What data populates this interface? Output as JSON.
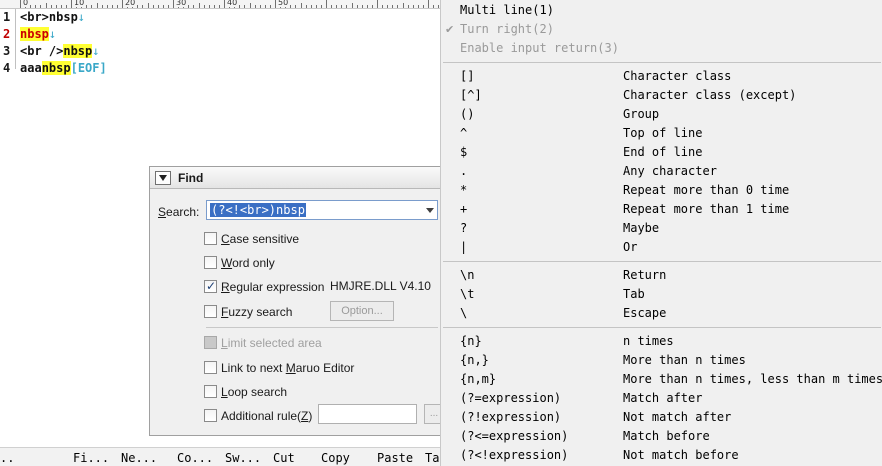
{
  "ruler": {
    "marks": [
      "0",
      "10",
      "20",
      "30",
      "40",
      "50"
    ]
  },
  "editor": {
    "lines": [
      {
        "num": "1",
        "segments": [
          {
            "text": "<br>nbsp",
            "style": ""
          },
          {
            "text": "↓",
            "style": "lf"
          }
        ]
      },
      {
        "num": "2",
        "segments": [
          {
            "text": "nbsp",
            "style": "hl-yel hl-red"
          },
          {
            "text": "↓",
            "style": "lf"
          }
        ]
      },
      {
        "num": "3",
        "segments": [
          {
            "text": "<br />",
            "style": ""
          },
          {
            "text": "nbsp",
            "style": "hl-yel"
          },
          {
            "text": "↓",
            "style": "lf"
          }
        ]
      },
      {
        "num": "4",
        "segments": [
          {
            "text": "aaa",
            "style": ""
          },
          {
            "text": "nbsp",
            "style": "hl-yel"
          },
          {
            "text": "[EOF]",
            "style": "eof"
          }
        ]
      }
    ]
  },
  "find": {
    "title": "Find",
    "search_label": "Search:",
    "search_value": "(?<!<br>)nbsp",
    "options": {
      "case_sensitive": "Case sensitive",
      "word_only": "Word only",
      "regular_expression": "Regular expression",
      "fuzzy_search": "Fuzzy search",
      "limit_selected_area": "Limit selected area",
      "link_next": "Link to next Maruo Editor",
      "loop_search": "Loop search",
      "additional_rule": "Additional rule(Z)"
    },
    "dll_version": "HMJRE.DLL V4.10",
    "option_button": "Option...",
    "more_button": "..."
  },
  "statusbar": {
    "items": [
      "..",
      "Fi...",
      "Ne...",
      "Co...",
      "Sw...",
      "Cut",
      "Copy",
      "Paste",
      "Ta"
    ]
  },
  "menu": {
    "top": [
      {
        "label": "Multi line(1)",
        "enabled": true,
        "checked": false
      },
      {
        "label": "Turn right(2)",
        "enabled": false,
        "checked": true
      },
      {
        "label": "Enable input return(3)",
        "enabled": false,
        "checked": false
      }
    ],
    "groups": [
      [
        {
          "key": "[]",
          "desc": "Character class"
        },
        {
          "key": "[^]",
          "desc": "Character class (except)"
        },
        {
          "key": "()",
          "desc": "Group"
        },
        {
          "key": "^",
          "desc": "Top of line"
        },
        {
          "key": "$",
          "desc": "End of line"
        },
        {
          "key": ".",
          "desc": "Any character"
        },
        {
          "key": "*",
          "desc": "Repeat more than 0 time"
        },
        {
          "key": "+",
          "desc": "Repeat more than 1 time"
        },
        {
          "key": "?",
          "desc": "Maybe"
        },
        {
          "key": "|",
          "desc": "Or"
        }
      ],
      [
        {
          "key": "\\n",
          "desc": "Return"
        },
        {
          "key": "\\t",
          "desc": "Tab"
        },
        {
          "key": "\\",
          "desc": "Escape"
        }
      ],
      [
        {
          "key": "{n}",
          "desc": "n times"
        },
        {
          "key": "{n,}",
          "desc": "More than n times"
        },
        {
          "key": "{n,m}",
          "desc": "More than n times, less than m times"
        },
        {
          "key": "(?=expression)",
          "desc": "Match after"
        },
        {
          "key": "(?!expression)",
          "desc": "Not match after"
        },
        {
          "key": "(?<=expression)",
          "desc": "Match before"
        },
        {
          "key": "(?<!expression)",
          "desc": "Not match before"
        }
      ]
    ]
  }
}
